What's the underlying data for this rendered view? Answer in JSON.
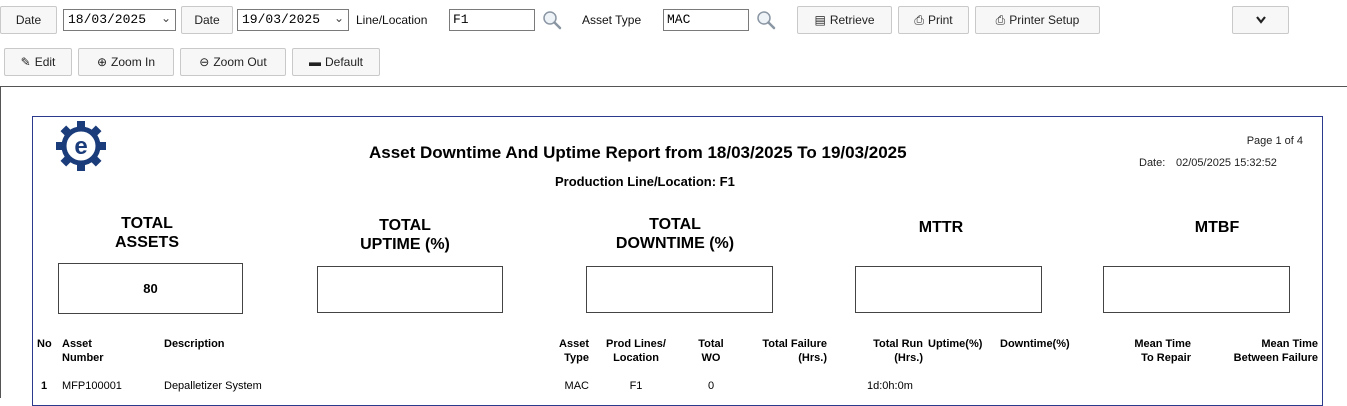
{
  "toolbar": {
    "date1_label": "Date",
    "date1_value": "18/03/2025",
    "date2_label": "Date",
    "date2_value": "19/03/2025",
    "line_label": "Line/Location",
    "line_value": "F1",
    "asset_type_label": "Asset Type",
    "asset_type_value": "MAC",
    "retrieve": "Retrieve",
    "print": "Print",
    "printer_setup": "Printer Setup",
    "edit": "Edit",
    "zoom_in": "Zoom In",
    "zoom_out": "Zoom Out",
    "default": "Default"
  },
  "report": {
    "title": "Asset Downtime And Uptime Report from 18/03/2025 To 19/03/2025",
    "subtitle": "Production Line/Location: F1",
    "page": "Page 1 of 4",
    "date_label": "Date:",
    "date_value": "02/05/2025 15:32:52",
    "kpis": {
      "total_assets_1": "TOTAL",
      "total_assets_2": "ASSETS",
      "total_assets_value": "80",
      "uptime_1": "TOTAL",
      "uptime_2": "UPTIME (%)",
      "downtime_1": "TOTAL",
      "downtime_2": "DOWNTIME (%)",
      "mttr": "MTTR",
      "mtbf": "MTBF"
    },
    "columns": {
      "no": "No",
      "asset_1": "Asset",
      "asset_2": "Number",
      "desc": "Description",
      "type_1": "Asset",
      "type_2": "Type",
      "prod_1": "Prod Lines/",
      "prod_2": "Location",
      "wo_1": "Total",
      "wo_2": "WO",
      "fail_1": "Total Failure",
      "fail_2": "(Hrs.)",
      "run_1": "Total Run",
      "run_2": "(Hrs.)",
      "uptime": "Uptime(%)",
      "downtime": "Downtime(%)",
      "mttr_1": "Mean Time",
      "mttr_2": "To Repair",
      "mtbf_1": "Mean Time",
      "mtbf_2": "Between Failure"
    },
    "rows": [
      {
        "no": "1",
        "asset": "MFP100001",
        "desc": "Depalletizer System",
        "type": "MAC",
        "prod": "F1",
        "wo": "0",
        "run": "1d:0h:0m"
      }
    ]
  }
}
